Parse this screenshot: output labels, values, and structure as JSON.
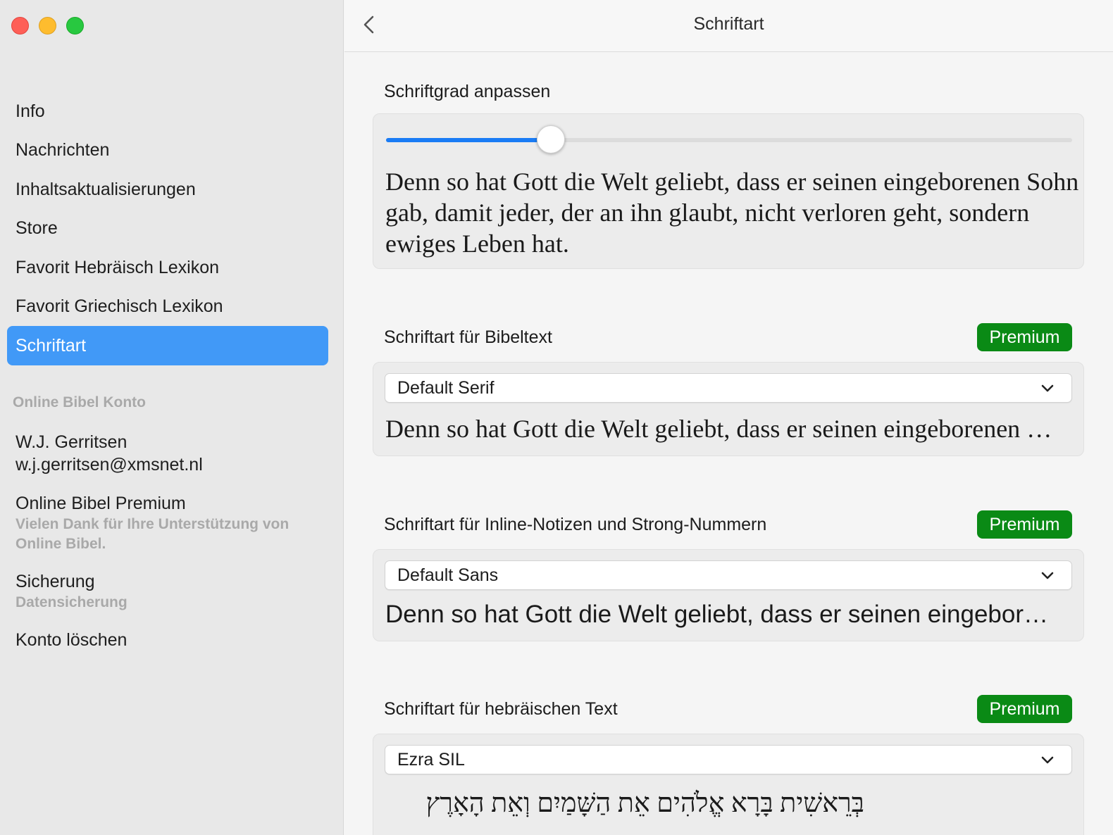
{
  "window": {
    "title": "Schriftart"
  },
  "sidebar": {
    "items": [
      {
        "label": "Info"
      },
      {
        "label": "Nachrichten"
      },
      {
        "label": "Inhaltsaktualisierungen"
      },
      {
        "label": "Store"
      },
      {
        "label": "Favorit Hebräisch Lexikon"
      },
      {
        "label": "Favorit Griechisch Lexikon"
      },
      {
        "label": "Schriftart",
        "active": true
      }
    ],
    "section_header": "Online Bibel Konto",
    "account": {
      "name": "W.J. Gerritsen",
      "email": "w.j.gerritsen@xmsnet.nl",
      "premium_title": "Online Bibel Premium",
      "premium_sub": "Vielen Dank für Ihre Unterstützung von Online Bibel.",
      "backup_title": "Sicherung",
      "backup_sub": "Datensicherung",
      "delete": "Konto löschen"
    }
  },
  "font_size": {
    "label": "Schriftgrad anpassen",
    "slider_value": 0.24,
    "preview": "Denn so hat Gott die Welt geliebt, dass er seinen eingeborenen Sohn gab, damit jeder, der an ihn glaubt, nicht verloren geht, sondern ewiges Leben hat."
  },
  "bible_font": {
    "label": "Schriftart für Bibeltext",
    "badge": "Premium",
    "selected": "Default Serif",
    "preview": "Denn so hat Gott die Welt geliebt, dass er seinen eingeborenen Sohn gab"
  },
  "notes_font": {
    "label": "Schriftart für Inline-Notizen und Strong-Nummern",
    "badge": "Premium",
    "selected": "Default Sans",
    "preview": "Denn so hat Gott die Welt geliebt, dass er seinen eingeborenen Sohn gab"
  },
  "hebrew_font": {
    "label": "Schriftart für hebräischen Text",
    "badge": "Premium",
    "selected": "Ezra SIL",
    "preview": "בְּרֵאשִׁית בָּרָא אֱלֹהִים אֵת הַשָּׁמַיִם וְאֵת הָאָרֶץ"
  },
  "colors": {
    "accent": "#1a7cf5",
    "sidebar_active": "#4199f7",
    "premium_badge": "#0a8a15"
  }
}
